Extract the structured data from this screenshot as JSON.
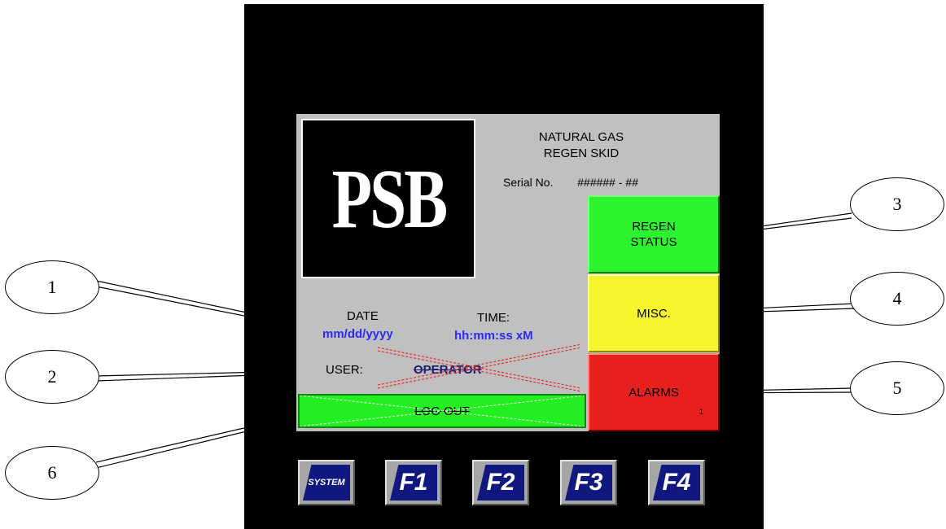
{
  "header": {
    "line1": "NATURAL GAS",
    "line2": "REGEN SKID",
    "serial_label": "Serial No.",
    "serial_value": "###### - ##"
  },
  "logo": {
    "text": "PSB"
  },
  "datetime": {
    "date_label": "DATE",
    "date_value": "mm/dd/yyyy",
    "time_label": "TIME:",
    "time_value": "hh:mm:ss xM"
  },
  "user": {
    "label": "USER:",
    "value": "OPERATOR"
  },
  "buttons": {
    "regen_status": "REGEN\nSTATUS",
    "misc": "MISC.",
    "alarms": "ALARMS",
    "alarms_count": "1",
    "logout": "LOG OUT"
  },
  "function_keys": [
    "SYSTEM",
    "F1",
    "F2",
    "F3",
    "F4"
  ],
  "callouts": [
    "1",
    "2",
    "3",
    "4",
    "5",
    "6"
  ],
  "colors": {
    "regen": "#2df52d",
    "misc": "#f5f52d",
    "alarms": "#e8201e",
    "logout": "#22ee22",
    "value_text": "#2a2aff",
    "fkey": "#101880"
  }
}
